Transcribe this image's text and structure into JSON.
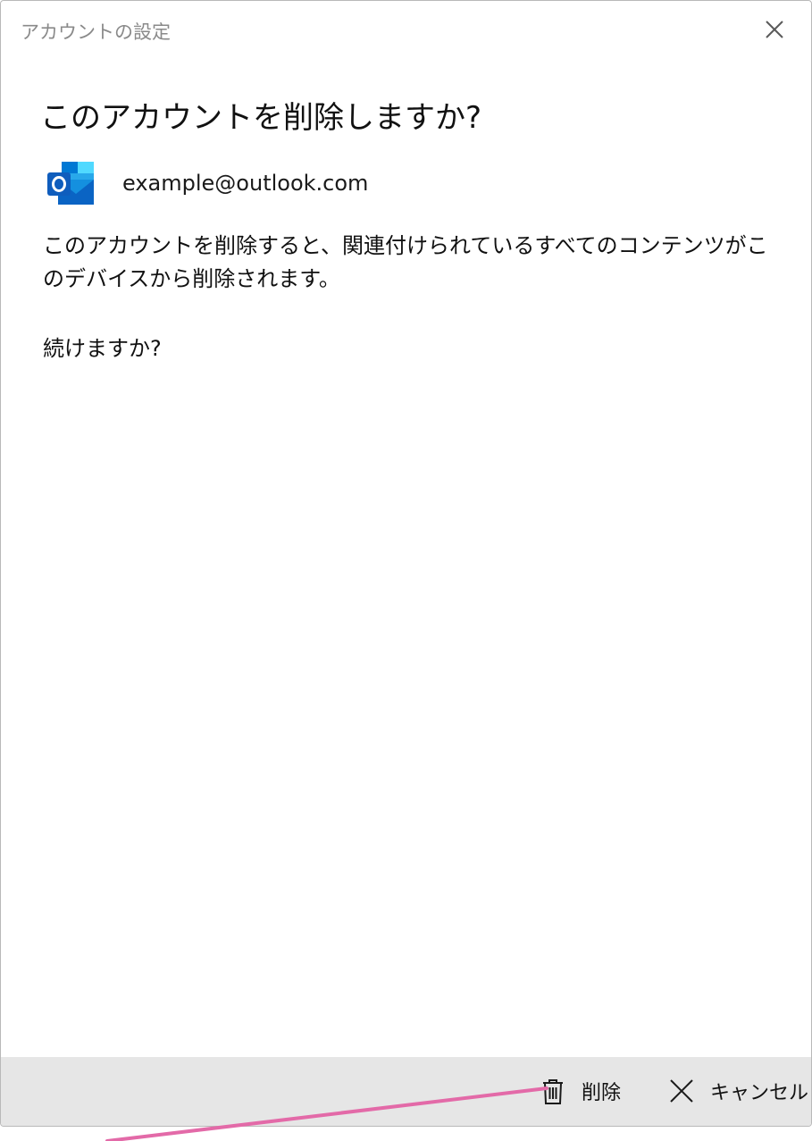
{
  "window": {
    "title": "アカウントの設定"
  },
  "dialog": {
    "heading": "このアカウントを削除しますか?",
    "account_email": "example@outlook.com",
    "message": "このアカウントを削除すると、関連付けられているすべてのコンテンツがこのデバイスから削除されます。",
    "confirm_question": "続けますか?"
  },
  "footer": {
    "delete_label": "削除",
    "cancel_label": "キャンセル"
  },
  "icons": {
    "app": "outlook-icon",
    "delete": "trash-icon",
    "cancel": "close-icon",
    "window_close": "close-icon"
  },
  "colors": {
    "outlook_blue": "#0a64c4",
    "footer_bg": "#e6e6e6",
    "annotation": "#e36aa8"
  }
}
